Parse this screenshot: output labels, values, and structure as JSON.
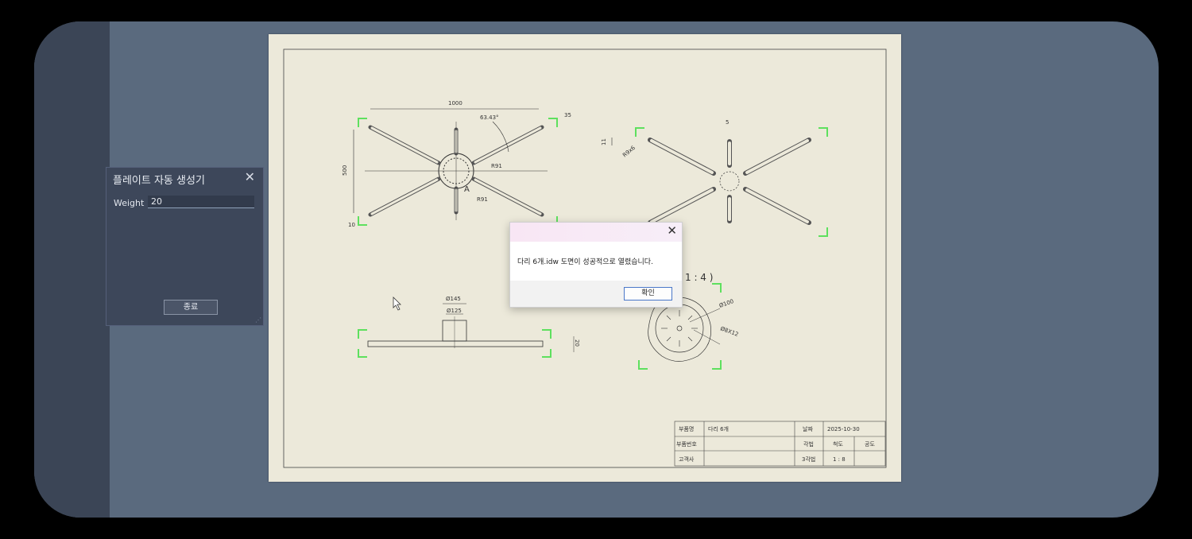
{
  "panel": {
    "title": "플레이트 자동 생성기",
    "close_glyph": "✕",
    "weight_label": "Weight",
    "weight_value": "20",
    "close_button_label": "종료"
  },
  "dialog": {
    "message": "다리 6개.idw 도면이 성공적으로 열렸습니다.",
    "ok_label": "확인",
    "close_glyph": "✕"
  },
  "drawing": {
    "dims": {
      "d1000": "1000",
      "angle": "63.43°",
      "d35": "35",
      "d500": "500",
      "r91a": "R91",
      "r91b": "R91",
      "d10": "10",
      "label_a": "A",
      "d5": "5",
      "d11": "11",
      "r9x6": "R9x6",
      "d145": "Ø145",
      "d125": "Ø125",
      "d20": "20",
      "d100": "Ø100",
      "d8x12": "Ø8X12",
      "scale_note": "1 : 4 )"
    },
    "title_block": {
      "part_name_label": "부품명",
      "part_name_value": "다리 6개",
      "date_label": "날짜",
      "date_value": "2025-10-30",
      "part_no_label": "부품번호",
      "method_label": "각법",
      "scale_label": "척도",
      "tolerance_label": "공도",
      "customer_label": "고객사",
      "method_value": "3각법",
      "scale_value": "1 : 8"
    }
  },
  "colors": {
    "background": "#5a6a7e",
    "sheet": "#ece9da",
    "panel": "#3d475a",
    "corner_marks": "#5ee05e"
  }
}
